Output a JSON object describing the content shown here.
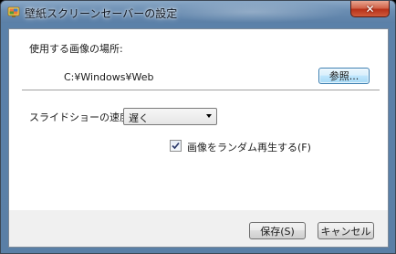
{
  "window": {
    "title": "壁紙スクリーンセーバーの設定",
    "close_glyph": "✕"
  },
  "location": {
    "label": "使用する画像の場所:",
    "path": "C:¥Windows¥Web",
    "browse_label": "参照..."
  },
  "speed": {
    "label": "スライドショーの速度(E):",
    "selected": "遅く"
  },
  "shuffle": {
    "label": "画像をランダム再生する(F)",
    "checked": true
  },
  "footer": {
    "save_label": "保存(S)",
    "cancel_label": "キャンセル"
  },
  "colors": {
    "title_bar": "#6a8db2",
    "close_button": "#c94a2e",
    "accent": "#3c7fb1"
  },
  "icons": {
    "app": "screensaver-icon",
    "close": "close-icon",
    "dropdown": "chevron-down-icon",
    "check": "checkmark-icon"
  }
}
